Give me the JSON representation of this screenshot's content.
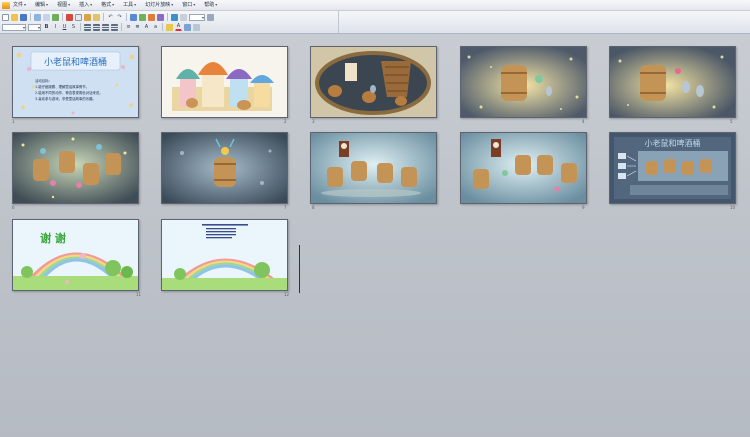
{
  "menubar": {
    "items": [
      "文件",
      "编辑",
      "视图",
      "插入",
      "格式",
      "工具",
      "幻灯片放映",
      "窗口",
      "帮助"
    ]
  },
  "slides": [
    {
      "number": "1",
      "title": "小老鼠和啤酒桶",
      "text": [
        "活动目标:",
        "1.能仔细观察、理解童话故事情节。",
        "2.能用不同的动作、神态表现角色对话来说。",
        "3.喜欢参与游戏，享受童话故事的乐趣。"
      ]
    },
    {
      "number": "2"
    },
    {
      "number": "3"
    },
    {
      "number": "4"
    },
    {
      "number": "5"
    },
    {
      "number": "6"
    },
    {
      "number": "7"
    },
    {
      "number": "8"
    },
    {
      "number": "9"
    },
    {
      "number": "10",
      "title": "小老鼠和啤酒桶"
    },
    {
      "number": "11",
      "title": "谢 谢"
    },
    {
      "number": "12"
    }
  ],
  "colors": {
    "window_bg": "#b9bec6",
    "slide1_title": "#2a6fc0",
    "thanks_green": "#3aa83a"
  }
}
